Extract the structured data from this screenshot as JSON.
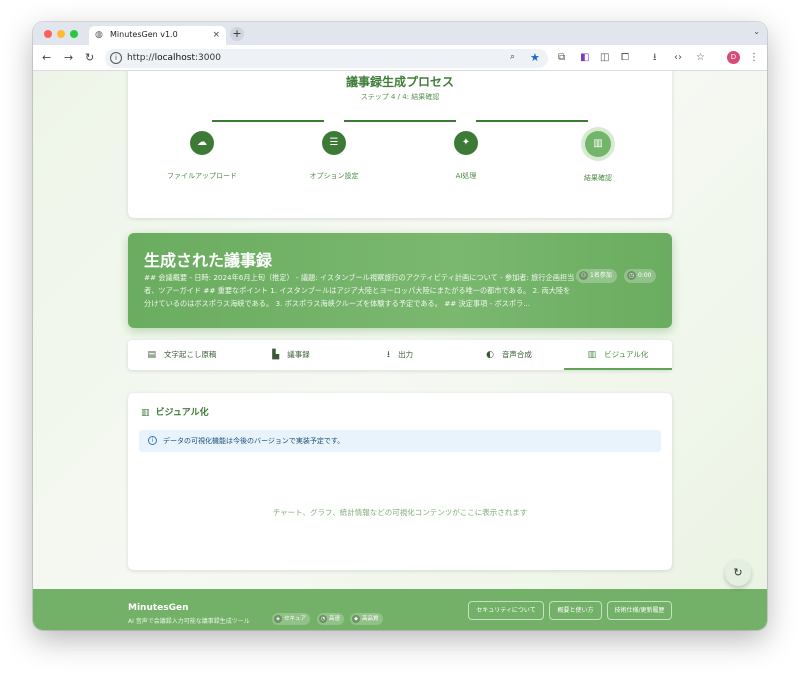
{
  "browser": {
    "tab_title": "MinutesGen v1.0",
    "tab_close": "×",
    "new_tab": "+",
    "tab_menu": "⌄",
    "url_host": "localhost",
    "url_port": ":3000",
    "url_scheme": "http://",
    "profile_initial": "D"
  },
  "process": {
    "title": "議事録生成プロセス",
    "step_text": "ステップ 4 / 4: 結果確認",
    "steps": [
      {
        "label": "ファイルアップロード",
        "icon": "☁"
      },
      {
        "label": "オプション設定",
        "icon": "☰"
      },
      {
        "label": "AI処理",
        "icon": "✦"
      },
      {
        "label": "結果確認",
        "icon": "▥"
      }
    ]
  },
  "result": {
    "title": "生成された議事録",
    "summary": "## 会議概要 - 日時: 2024年6月上旬（推定） - 議題: イスタンブール視察旅行のアクティビティ計画について - 参加者: 旅行企画担当者、ツアーガイド ## 重要なポイント 1. イスタンブールはアジア大陸とヨーロッパ大陸にまたがる唯一の都市である。 2. 両大陸を分けているのはボスポラス海峡である。 3. ボスポラス海峡クルーズを体験する予定である。 ## 決定事項 - ボスポラ...",
    "participants": "1名参加",
    "duration": "0:00"
  },
  "tabs": [
    {
      "label": "文字起こし原稿",
      "icon": "▤"
    },
    {
      "label": "議事録",
      "icon": "▙"
    },
    {
      "label": "出力",
      "icon": "⭳"
    },
    {
      "label": "音声合成",
      "icon": "◐"
    },
    {
      "label": "ビジュアル化",
      "icon": "▥"
    }
  ],
  "visualization": {
    "title": "ビジュアル化",
    "notice": "データの可視化機能は今後のバージョンで実装予定です。",
    "placeholder": "チャート、グラフ、統計情報などの可視化コンテンツがここに表示されます"
  },
  "footer": {
    "brand": "MinutesGen",
    "tagline": "AI 音声で会議録入力可能な議事録生成ツール",
    "badges": [
      "セキュア",
      "高速",
      "高品質"
    ],
    "links": [
      "セキュリティについて",
      "概要と使い方",
      "技術仕様/更新履歴"
    ]
  },
  "colors": {
    "primary": "#3c7a35",
    "accent": "#73b56a",
    "banner": "#6aac60",
    "footer": "#72b167",
    "info_bg": "#e8f3fc"
  }
}
